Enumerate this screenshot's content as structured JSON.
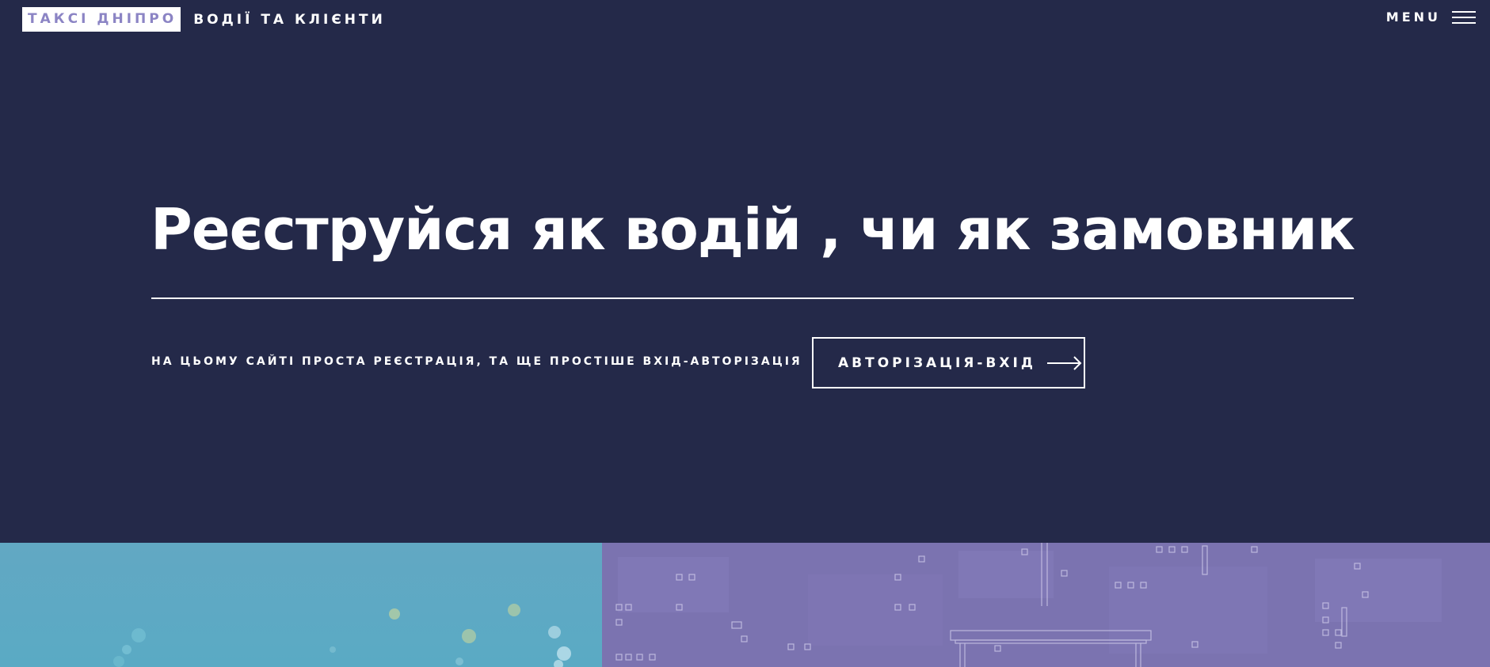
{
  "header": {
    "logo_primary": "ТАКСІ ДНІПРО",
    "logo_secondary": "ВОДІЇ ТА КЛІЄНТИ",
    "menu_label": "MENU"
  },
  "hero": {
    "title": "Реєструйся як водій , чи як замовник",
    "subtitle": "НА ЦЬОМУ САЙТІ ПРОСТА РЕЄСТРАЦІЯ, ТА ЩЕ ПРОСТІШЕ ВХІД-АВТОРІЗАЦІЯ",
    "cta_label": "АВТОРІЗАЦІЯ-ВХІД"
  },
  "tiles": [
    {
      "name": "tile-left",
      "color": "#5fa9c4"
    },
    {
      "name": "tile-right",
      "color": "#7b73b0"
    }
  ],
  "colors": {
    "background": "#242949",
    "accent": "#8b84c4",
    "text": "#ffffff"
  },
  "icons": {
    "menu": "hamburger-icon",
    "cta": "arrow-right-icon"
  }
}
